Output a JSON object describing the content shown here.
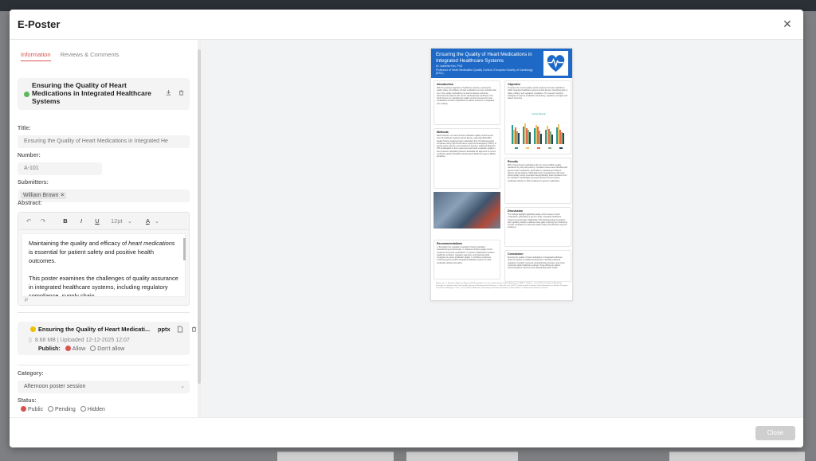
{
  "modal": {
    "title": "E-Poster",
    "close_label": "Close"
  },
  "tabs": [
    {
      "label": "Information",
      "active": true
    },
    {
      "label": "Reviews & Comments",
      "active": false
    }
  ],
  "poster_card": {
    "title": "Ensuring the Quality of Heart Medications in Integrated Healthcare Systems",
    "status_color": "#5cb85c"
  },
  "fields": {
    "title_label": "Title:",
    "title_value": "Ensuring the Quality of Heart Medications in Integrated He",
    "number_label": "Number:",
    "number_value": "A-101",
    "submitters_label": "Submitters:",
    "submitter": "William Brown",
    "abstract_label": "Abstract:"
  },
  "editor": {
    "font_size": "12pt",
    "status_path": "P",
    "paragraph1_a": "Maintaining the quality and efficacy of ",
    "paragraph1_em": "heart medications",
    "paragraph1_b": " is essential for patient safety and positive health outcomes.",
    "paragraph2": "This poster examines the challenges of quality assurance in integrated healthcare systems, including regulatory compliance, supply chain"
  },
  "file": {
    "name": "Ensuring the Quality of Heart Medicati...",
    "ext": "pptx",
    "meta": "8.68 MB | Uploaded 12-12-2025 12:07",
    "publish_label": "Publish:",
    "allow": "Allow",
    "dont_allow": "Don't allow",
    "status_color": "#f0c000"
  },
  "category": {
    "label": "Category:",
    "value": "Afternoon poster session"
  },
  "status": {
    "label": "Status:",
    "options": [
      "Public",
      "Pending",
      "Hidden"
    ],
    "selected": "Public"
  },
  "poster": {
    "title": "Ensuring the Quality of Heart Medications in Integrated Healthcare Systems",
    "author": "Dr. Isabella Kim, PhD",
    "affiliation": "Professor of Heart Medication Quality Control, European Society of Cardiology (ESC)",
    "sections": {
      "intro_h": "Introduction",
      "intro_t": "With the growing integration of healthcare systems, ensuring the quality, safety, and efficacy of heart medications is more important than ever. Poor quality medications can lead to adverse outcomes, particularly for patients with chronic cardiovascular conditions. This study focuses on evaluating the quality control processes for heart medications and their implications for patient outcomes in integrated care settings.",
      "objective_h": "Objective",
      "objective_t": "To assess the current quality control measures of heart medications within integrated healthcare systems across Europe, identifying gaps in safety, efficacy, and regulatory compliance. The research explores strategies to improve medication consistency, regulatory oversight, and patient outcomes.",
      "methods_h": "Methods",
      "methods_t": "Data Collection: A review of heart medication quality control reports from 20 healthcare systems across Europe, spanning 2015-2023. Quality Testing: Analyzed heart medications from 15 pharmaceutical companies using High-Performance Liquid Chromatography (HPLC) to assess purity, potency, and consistency. Surveys: Collected data from 150 cardiologists on their experiences with heart medication quality in their practices. Regulatory Review: Evaluated the alignment of current medication quality standards with European Medicines Agency (EMA) guidelines.",
      "results_h": "Results",
      "results_t": "68% of tested heart medications did not meet the EMA's quality standards for purity and potency. Consistent issues were identified with generic heart medications, particularly in maintaining consistent potency across batches. Medications from manufacturers with more robust quality control processes had significantly fewer deviations from the standard. Cardiologists surveyed reported concerns about medication efficacy in 12% of patients on generic medications.",
      "discussion_h": "Discussion",
      "discussion_t": "The findings highlight significant quality control issues in heart medications, particularly in generic drugs. Integrated healthcare systems need stronger collaboration with pharmaceutical companies and regulatory bodies to address these gaps. Ensuring the consistency of heart medications is critical for patient safety and effective long-term treatment.",
      "recs_h": "Recommendations",
      "recs_t": "1. Strengthen the regulatory oversight of heart medication manufacturing across Europe. 2. Implement stricter quality control measures for generic medications. 3. Improve collaboration between healthcare providers, regulatory agencies, and pharmaceutical companies to ensure medication quality. 4. Introduce continuous monitoring systems within integrated healthcare systems to track medication efficacy and safety.",
      "conclusion_h": "Conclusion",
      "conclusion_t": "Ensuring the quality of heart medications in integrated healthcare systems requires a multifaceted approach, including enhanced regulatory oversight, improved manufacturing processes, and closer monitoring within healthcare settings. These efforts are vital for improving patient outcomes and safeguarding public health.",
      "refs": "References: 1. European Medicines Agency (2023). Guidelines for the Quality Control of Heart Medications. EMA. 2. Smith, J., et al. (2021). The Role of Regulatory Oversight in Cardiovascular Drug Quality. Journal of Pharmaceutical Sciences. 3. Jones, A. et al. (2022). Quality Control of Generic Heart Medications in Europe. European Journal of Cardiology. 4. Chen, Y. et al. (2020). Medication Consistency and Patient Outcomes in Heart Failure. Cardiovascular Research Journal."
    },
    "chart_title": "Survey Results"
  },
  "colors": {
    "accent": "#d9534f",
    "poster_blue": "#1f69c6"
  }
}
